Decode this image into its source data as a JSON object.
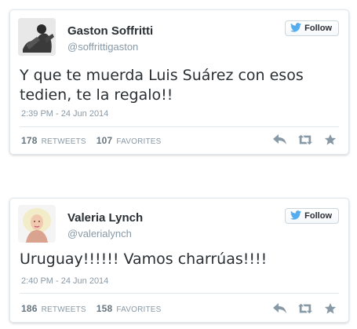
{
  "colors": {
    "follow_bird": "#55acee",
    "name": "#292f33",
    "muted": "#8899a6",
    "action_icons": "#8899a6"
  },
  "tweets": [
    {
      "name": "Gaston Soffritti",
      "handle": "@soffrittigaston",
      "follow_label": "Follow",
      "text": "Y que te muerda Luis Suárez con esos tedien, te la regalo!!",
      "timestamp": "2:39 PM - 24 Jun 2014",
      "retweets_count": "178",
      "retweets_label": "RETWEETS",
      "favorites_count": "107",
      "favorites_label": "FAVORITES",
      "icons": [
        "twitter-bird-icon",
        "reply-icon",
        "retweet-icon",
        "favorite-star-icon"
      ]
    },
    {
      "name": "Valeria Lynch",
      "handle": "@valerialynch",
      "follow_label": "Follow",
      "text": "Uruguay!!!!!! Vamos charrúas!!!!",
      "timestamp": "2:40 PM - 24 Jun 2014",
      "retweets_count": "186",
      "retweets_label": "RETWEETS",
      "favorites_count": "158",
      "favorites_label": "FAVORITES",
      "icons": [
        "twitter-bird-icon",
        "reply-icon",
        "retweet-icon",
        "favorite-star-icon"
      ]
    }
  ]
}
